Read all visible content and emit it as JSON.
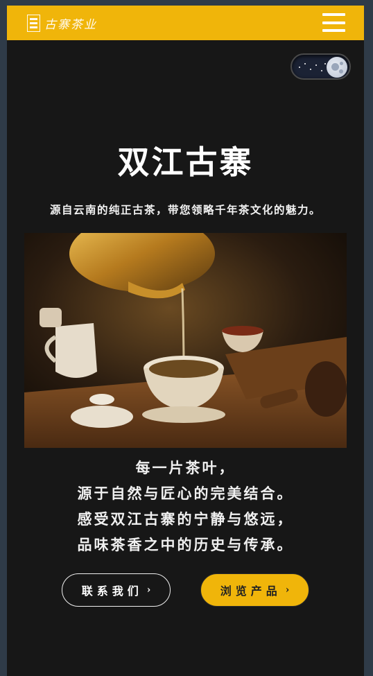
{
  "header": {
    "logo_text": "古寨茶业",
    "menu_icon": "hamburger-menu-icon",
    "background": "#f0b50a"
  },
  "theme_toggle": {
    "icon": "moon-icon",
    "mode": "dark"
  },
  "hero": {
    "title": "双江古寨",
    "subtitle": "源自云南的纯正古茶，带您领略千年茶文化的魅力。",
    "image_description_icon": "tea-pouring-photo"
  },
  "verse": {
    "lines": [
      "每一片茶叶，",
      "源于自然与匠心的完美结合。",
      "感受双江古寨的宁静与悠远，",
      "品味茶香之中的历史与传承。"
    ]
  },
  "buttons": {
    "contact_label": "联系我们",
    "browse_label": "浏览产品",
    "chevron": "›"
  },
  "colors": {
    "accent": "#f0b50a",
    "page_bg": "#171717"
  }
}
